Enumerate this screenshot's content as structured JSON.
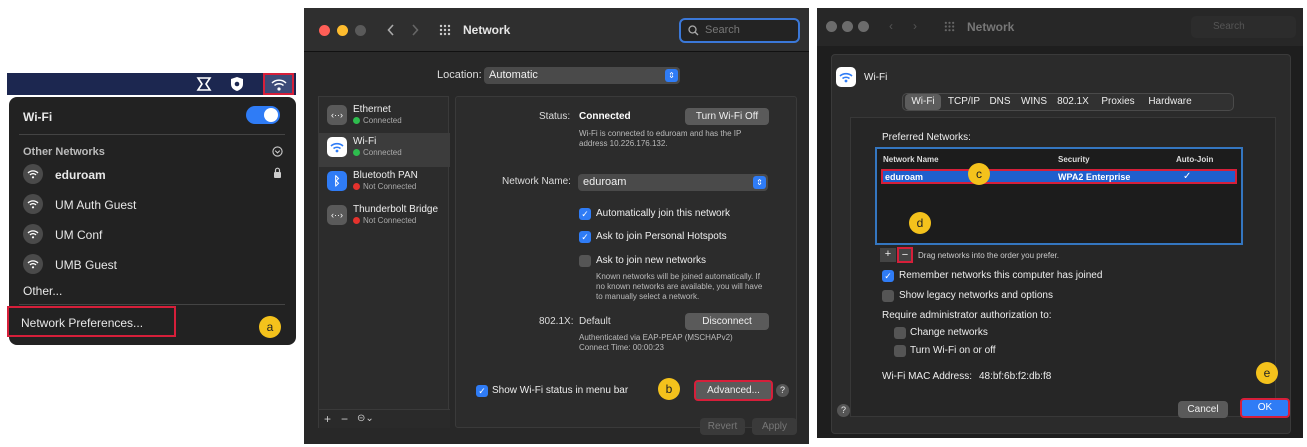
{
  "badges": {
    "a": "a",
    "b": "b",
    "c": "c",
    "d": "d",
    "e": "e"
  },
  "wifi_menu": {
    "title": "Wi-Fi",
    "section": "Other Networks",
    "networks": [
      "eduroam",
      "UM Auth Guest",
      "UM Conf",
      "UMB Guest"
    ],
    "other": "Other...",
    "prefs": "Network Preferences..."
  },
  "network_prefs": {
    "title": "Network",
    "search_placeholder": "Search",
    "location_label": "Location:",
    "location_value": "Automatic",
    "services": [
      {
        "name": "Ethernet",
        "status": "Connected",
        "icon": "ethernet-icon"
      },
      {
        "name": "Wi-Fi",
        "status": "Connected",
        "icon": "wifi-icon"
      },
      {
        "name": "Bluetooth PAN",
        "status": "Not Connected",
        "icon": "bluetooth-icon"
      },
      {
        "name": "Thunderbolt Bridge",
        "status": "Not Connected",
        "icon": "thunderbolt-icon"
      }
    ],
    "status_label": "Status:",
    "status_value": "Connected",
    "turn_off": "Turn Wi-Fi Off",
    "status_desc1": "Wi-Fi is connected to eduroam and has the IP",
    "status_desc2": "address 10.226.176.132.",
    "network_name_label": "Network Name:",
    "network_name_value": "eduroam",
    "auto_join": "Automatically join this network",
    "hotspots": "Ask to join Personal Hotspots",
    "new_networks": "Ask to join new networks",
    "known1": "Known networks will be joined automatically. If",
    "known2": "no known networks are available, you will have",
    "known3": "to manually select a network.",
    "dot1x_label": "802.1X:",
    "dot1x_value": "Default",
    "disconnect": "Disconnect",
    "auth1": "Authenticated via EAP-PEAP (MSCHAPv2)",
    "auth2": "Connect Time: 00:00:23",
    "show_status": "Show Wi-Fi status in menu bar",
    "advanced": "Advanced...",
    "help": "?",
    "revert": "Revert",
    "apply": "Apply",
    "plus": "+",
    "minus": "−",
    "action": "⊝⌄"
  },
  "advanced": {
    "title": "Network",
    "search_placeholder": "Search",
    "header": "Wi-Fi",
    "tabs": [
      "Wi-Fi",
      "TCP/IP",
      "DNS",
      "WINS",
      "802.1X",
      "Proxies",
      "Hardware"
    ],
    "preferred": "Preferred Networks:",
    "columns": [
      "Network Name",
      "Security",
      "Auto-Join"
    ],
    "row": {
      "name": "eduroam",
      "security": "WPA2 Enterprise",
      "auto": "✓"
    },
    "plus": "+",
    "minus": "−",
    "drag_hint": "Drag networks into the order you prefer.",
    "remember": "Remember networks this computer has joined",
    "legacy": "Show legacy networks and options",
    "require": "Require administrator authorization to:",
    "change": "Change networks",
    "turn": "Turn Wi-Fi on or off",
    "mac_label": "Wi-Fi MAC Address:",
    "mac_value": "48:bf:6b:f2:db:f8",
    "help": "?",
    "cancel": "Cancel",
    "ok": "OK"
  }
}
